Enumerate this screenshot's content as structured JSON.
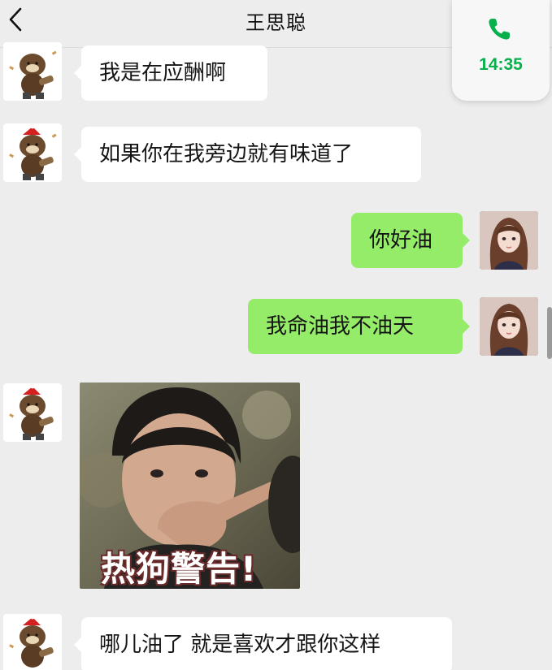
{
  "header": {
    "title": "王思聪"
  },
  "call": {
    "time": "14:35",
    "accent_color": "#07b04b"
  },
  "messages": {
    "m1": "我是在应酬啊",
    "m2": "如果你在我旁边就有味道了",
    "m3": "你好油",
    "m4": "我命油我不油天",
    "m5_caption": "热狗警告!",
    "m6": "哪儿油了 就是喜欢才跟你这样"
  },
  "colors": {
    "sent_bubble": "#95ec69",
    "received_bubble": "#ffffff",
    "background": "#ededed"
  },
  "icons": {
    "back": "chevron-left-icon",
    "call": "phone-icon"
  }
}
